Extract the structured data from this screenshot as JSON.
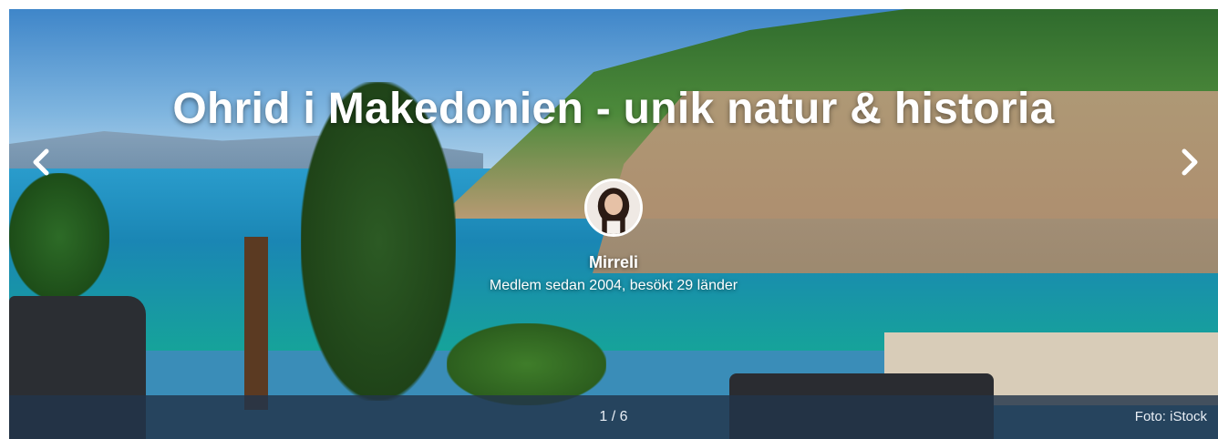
{
  "hero": {
    "title": "Ohrid i Makedonien - unik natur & historia",
    "author": {
      "name": "Mirreli",
      "subtitle": "Medlem sedan 2004, besökt 29 länder"
    },
    "slide_counter": "1 / 6",
    "photo_credit": "Foto: iStock",
    "icons": {
      "prev": "chevron-left-icon",
      "next": "chevron-right-icon"
    }
  }
}
